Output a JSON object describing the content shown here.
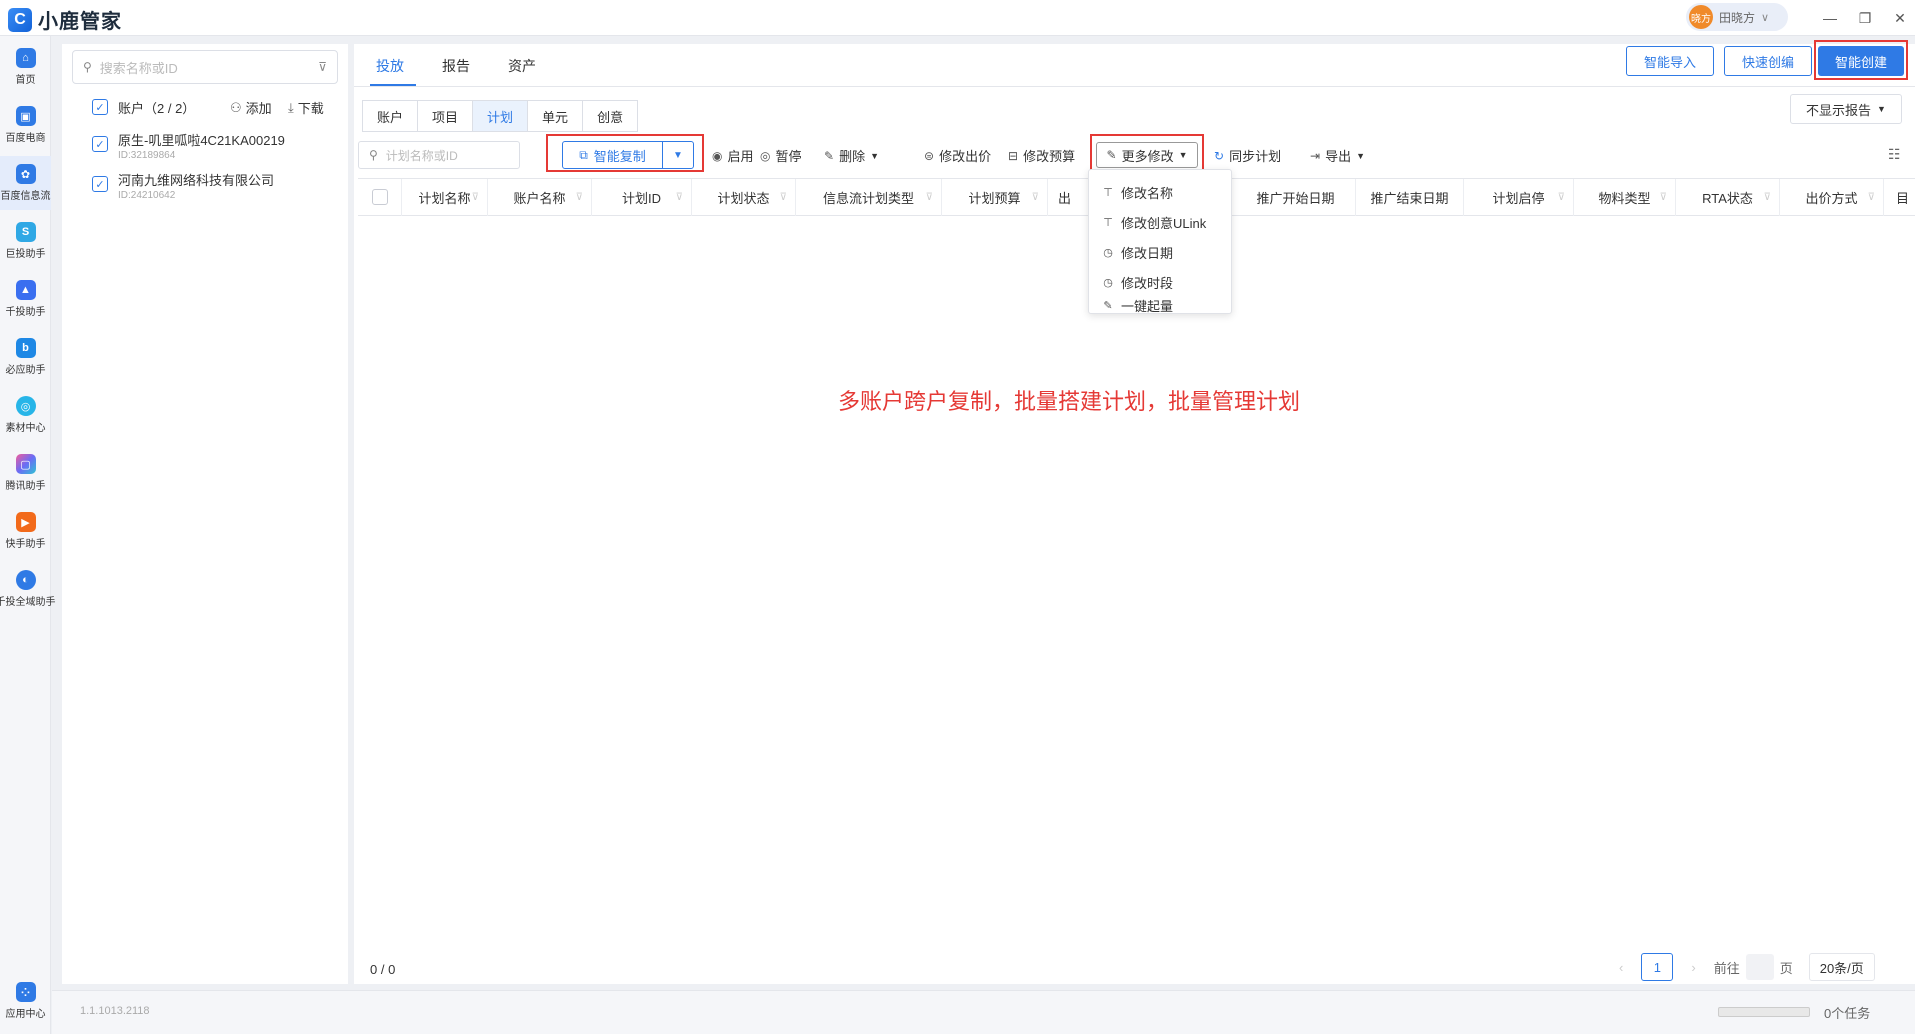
{
  "app": {
    "title": "小鹿管家"
  },
  "user": {
    "avatar_text": "晓方",
    "name": "田晓方"
  },
  "rail": {
    "items": [
      {
        "label": "首页",
        "color": "#2f7ae5"
      },
      {
        "label": "百度电商",
        "color": "#2f7ae5"
      },
      {
        "label": "百度信息流",
        "color": "#2f7ae5"
      },
      {
        "label": "巨投助手",
        "color": "#2fa8e5"
      },
      {
        "label": "千投助手",
        "color": "#3a6ff0"
      },
      {
        "label": "必应助手",
        "color": "#1e88e5"
      },
      {
        "label": "素材中心",
        "color": "#27b5e8"
      },
      {
        "label": "腾讯助手",
        "color": "#9b59f0"
      },
      {
        "label": "快手助手",
        "color": "#f26a1b"
      },
      {
        "label": "千投全域助手",
        "color": "#2f7ae5"
      }
    ],
    "app_center": "应用中心"
  },
  "account_panel": {
    "search_placeholder": "搜索名称或ID",
    "header": "账户（2 / 2）",
    "add_label": "添加",
    "download_label": "下载",
    "accounts": [
      {
        "name": "原生-叽里呱啦4C21KA00219",
        "id": "ID:32189864"
      },
      {
        "name": "河南九维网络科技有限公司",
        "id": "ID:24210642"
      }
    ]
  },
  "main": {
    "tabs": [
      "投放",
      "报告",
      "资产"
    ],
    "actions": {
      "import": "智能导入",
      "quick_edit": "快速创编",
      "smart_create": "智能创建"
    },
    "sub_tabs": [
      "账户",
      "项目",
      "计划",
      "单元",
      "创意"
    ],
    "report_toggle": "不显示报告",
    "toolbar": {
      "search_placeholder": "计划名称或ID",
      "smart_copy": "智能复制",
      "enable": "启用",
      "pause": "暂停",
      "delete": "删除",
      "edit_bid": "修改出价",
      "edit_budget": "修改预算",
      "more_edit": "更多修改",
      "sync": "同步计划",
      "export": "导出"
    },
    "columns": [
      "计划名称",
      "账户名称",
      "计划ID",
      "计划状态",
      "信息流计划类型",
      "计划预算",
      "出",
      "推广开始日期",
      "推广结束日期",
      "计划启停",
      "物料类型",
      "RTA状态",
      "出价方式",
      "目"
    ],
    "more_menu": [
      "修改名称",
      "修改创意ULink",
      "修改日期",
      "修改时段",
      "一键起量"
    ],
    "annotation": "多账户跨户复制，批量搭建计划，批量管理计划",
    "footer": {
      "count": "0 / 0",
      "page": "1",
      "goto_label": "前往",
      "page_unit": "页",
      "page_size": "20条/页"
    }
  },
  "status": {
    "version": "1.1.1013.2118",
    "tasks": "0个任务"
  },
  "colors": {
    "accent": "#2f7ae5",
    "highlight": "#e53935"
  }
}
